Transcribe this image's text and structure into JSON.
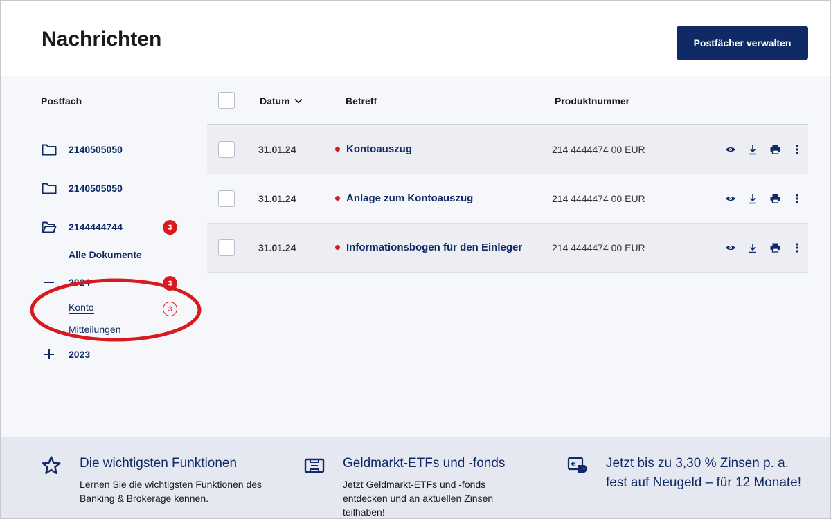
{
  "header": {
    "title": "Nachrichten",
    "manage_button": "Postfächer verwalten"
  },
  "sidebar": {
    "title": "Postfach",
    "accounts": [
      {
        "label": "2140505050",
        "icon": "folder-icon"
      },
      {
        "label": "2140505050",
        "icon": "folder-icon"
      },
      {
        "label": "2144444744",
        "icon": "folder-open-icon",
        "badge": "3"
      }
    ],
    "all_documents": "Alle Dokumente",
    "year_2024": {
      "label": "2024",
      "badge": "3",
      "icon": "minus-icon"
    },
    "sub_konto": {
      "label": "Konto",
      "badge": "3"
    },
    "sub_mitteilungen": {
      "label": "Mitteilungen"
    },
    "year_2023": {
      "label": "2023",
      "icon": "plus-icon"
    }
  },
  "table": {
    "columns": {
      "date": "Datum",
      "subject": "Betreff",
      "product": "Produktnummer"
    },
    "rows": [
      {
        "date": "31.01.24",
        "subject": "Kontoauszug",
        "product": "214 4444474 00 EUR",
        "unread": true
      },
      {
        "date": "31.01.24",
        "subject": "Anlage zum Kontoauszug",
        "product": "214 4444474 00 EUR",
        "unread": true
      },
      {
        "date": "31.01.24",
        "subject": "Informationsbogen für den Einleger",
        "product": "214 4444474 00 EUR",
        "unread": true
      }
    ]
  },
  "promo": [
    {
      "icon": "star-icon",
      "title": "Die wichtigsten Funktionen",
      "text": "Lernen Sie die wichtigsten Funktionen des Banking & Brokerage kennen."
    },
    {
      "icon": "etf-icon",
      "title": "Geldmarkt-ETFs und -fonds",
      "text": "Jetzt Geldmarkt-ETFs und -fonds entdecken und an aktuellen Zinsen teilhaben!"
    },
    {
      "icon": "savings-icon",
      "title": "Jetzt bis zu 3,30 % Zinsen p. a. fest auf Neugeld – für 12 Monate!",
      "text": ""
    }
  ],
  "colors": {
    "brand_navy": "#0f2a64",
    "alert_red": "#d8191e",
    "content_bg": "#f6f7fa",
    "promo_bg": "#e6e8f1"
  }
}
